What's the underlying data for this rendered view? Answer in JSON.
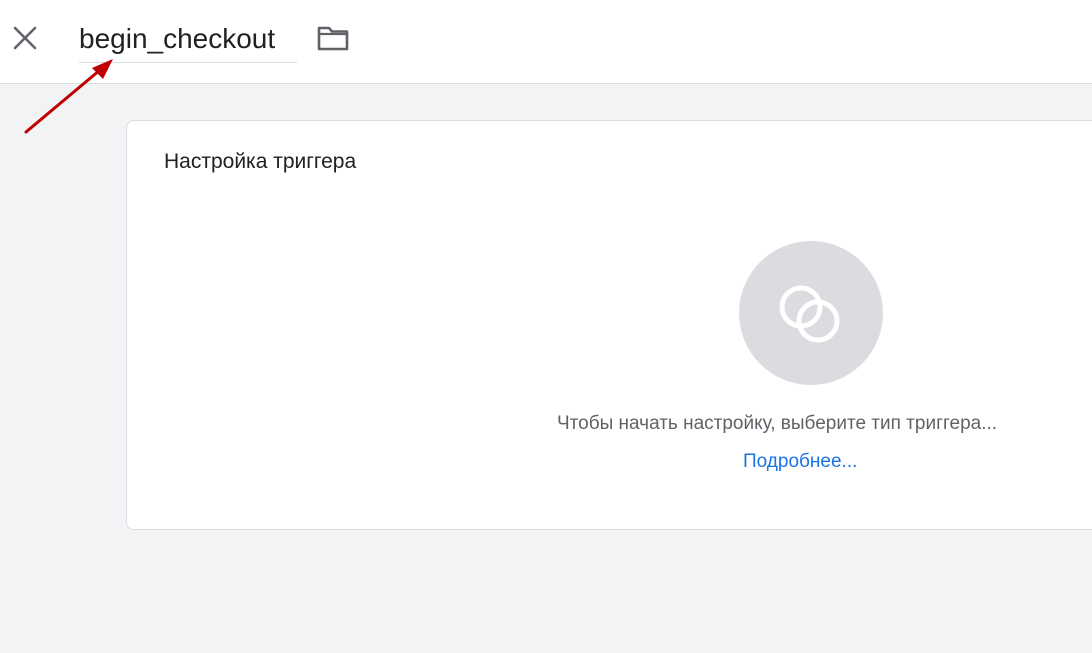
{
  "header": {
    "close_icon": "close-icon",
    "tag_name_value": "begin_checkout",
    "folder_icon": "folder-icon"
  },
  "annotation": {
    "arrow_color": "#c00000"
  },
  "trigger_card": {
    "title": "Настройка триггера",
    "placeholder_icon": "trigger-type-icon",
    "hint": "Чтобы начать настройку, выберите тип триггера...",
    "learn_more": "Подробнее..."
  },
  "colors": {
    "link": "#1a73e8",
    "background": "#f1f3f4",
    "icon_circle": "#dadce0"
  }
}
